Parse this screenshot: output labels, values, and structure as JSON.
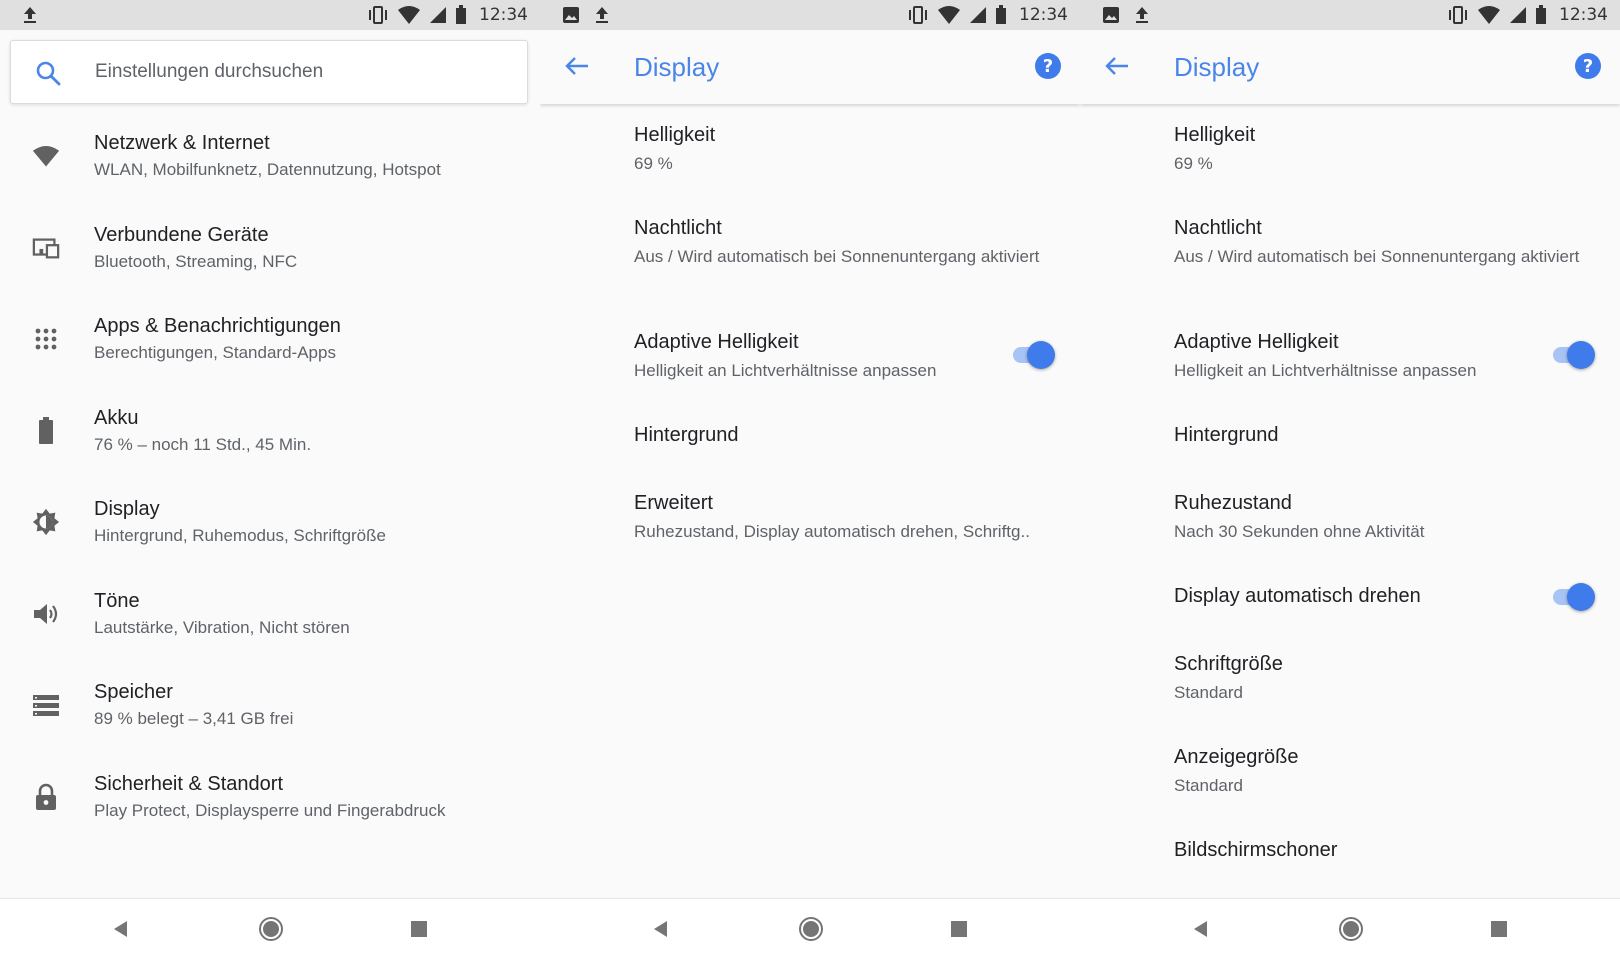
{
  "status_bar": {
    "time": "12:34"
  },
  "settings_list": {
    "search_placeholder": "Einstellungen durchsuchen",
    "items": [
      {
        "title": "Netzwerk & Internet",
        "subtitle": "WLAN, Mobilfunknetz, Datennutzung, Hotspot",
        "icon": "wifi-icon"
      },
      {
        "title": "Verbundene Geräte",
        "subtitle": "Bluetooth, Streaming, NFC",
        "icon": "devices-icon"
      },
      {
        "title": "Apps & Benachrichtigungen",
        "subtitle": "Berechtigungen, Standard-Apps",
        "icon": "apps-grid-icon"
      },
      {
        "title": "Akku",
        "subtitle": "76 % – noch 11 Std., 45 Min.",
        "icon": "battery-icon"
      },
      {
        "title": "Display",
        "subtitle": "Hintergrund, Ruhemodus, Schriftgröße",
        "icon": "brightness-icon"
      },
      {
        "title": "Töne",
        "subtitle": "Lautstärke, Vibration, Nicht stören",
        "icon": "volume-icon"
      },
      {
        "title": "Speicher",
        "subtitle": "89 % belegt – 3,41 GB frei",
        "icon": "storage-icon"
      },
      {
        "title": "Sicherheit & Standort",
        "subtitle": "Play Protect, Displaysperre und Fingerabdruck",
        "icon": "lock-icon"
      }
    ]
  },
  "display_collapsed": {
    "title": "Display",
    "items": [
      {
        "title": "Helligkeit",
        "subtitle": "69 %"
      },
      {
        "title": "Nachtlicht",
        "subtitle": "Aus / Wird automatisch bei Sonnenuntergang aktiviert"
      },
      {
        "title": "Adaptive Helligkeit",
        "subtitle": "Helligkeit an Lichtverhältnisse anpassen",
        "toggle": true
      },
      {
        "title": "Hintergrund"
      },
      {
        "title": "Erweitert",
        "subtitle": "Ruhezustand, Display automatisch drehen, Schriftg.."
      }
    ]
  },
  "display_expanded": {
    "title": "Display",
    "items": [
      {
        "title": "Helligkeit",
        "subtitle": "69 %"
      },
      {
        "title": "Nachtlicht",
        "subtitle": "Aus / Wird automatisch bei Sonnenuntergang aktiviert"
      },
      {
        "title": "Adaptive Helligkeit",
        "subtitle": "Helligkeit an Lichtverhältnisse anpassen",
        "toggle": true
      },
      {
        "title": "Hintergrund"
      },
      {
        "title": "Ruhezustand",
        "subtitle": "Nach 30 Sekunden ohne Aktivität"
      },
      {
        "title": "Display automatisch drehen",
        "toggle": true
      },
      {
        "title": "Schriftgröße",
        "subtitle": "Standard"
      },
      {
        "title": "Anzeigegröße",
        "subtitle": "Standard"
      },
      {
        "title": "Bildschirmschoner"
      }
    ]
  },
  "colors": {
    "accent": "#4a86e8",
    "switch_on": "#3f7bea",
    "background": "#fafafa"
  }
}
